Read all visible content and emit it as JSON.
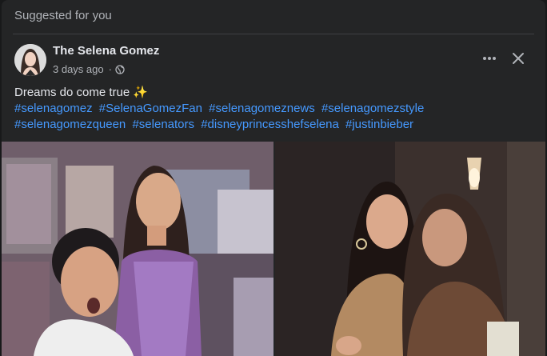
{
  "feed": {
    "section_label": "Suggested for you"
  },
  "post": {
    "author": "The Selena Gomez",
    "time": "3 days ago",
    "separator": "·",
    "privacy_icon": "globe-icon",
    "text": "Dreams do come true ✨",
    "hashtags": [
      "#selenagomez",
      "#SelenaGomezFan",
      "#selenagomeznews",
      "#selenagomezstyle",
      "#selenagomezqueen",
      "#selenators",
      "#disneyprincesshefselena",
      "#justinbieber"
    ],
    "photos": [
      {
        "icon": "photo-fan-with-cutout"
      },
      {
        "icon": "photo-fan-hugging-selena"
      }
    ]
  },
  "colors": {
    "background": "#18191a",
    "card": "#242526",
    "primary_text": "#e4e6eb",
    "secondary_text": "#b0b3b8",
    "link": "#4599ff"
  }
}
